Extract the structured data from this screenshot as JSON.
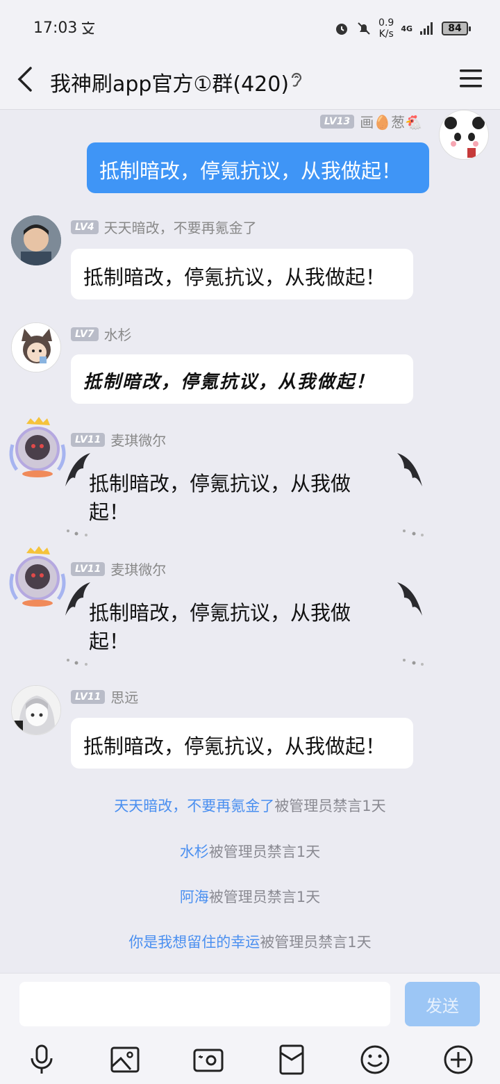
{
  "status": {
    "time": "17:03",
    "net_speed": "0.9",
    "net_unit": "K/s",
    "network": "4G",
    "battery": "84"
  },
  "header": {
    "title": "我神刷app官方①群(420)"
  },
  "messages": [
    {
      "level": "LV13",
      "sender": "画🥚葱🐔",
      "text": "抵制暗改，停氪抗议，从我做起！"
    },
    {
      "level": "LV4",
      "sender": "天天暗改，不要再氪金了",
      "text": "抵制暗改，停氪抗议，从我做起！"
    },
    {
      "level": "LV7",
      "sender": "水杉",
      "text": "抵制暗改，停氪抗议，从我做起！"
    },
    {
      "level": "LV11",
      "sender": "麦琪微尔",
      "text": "抵制暗改，停氪抗议，从我做起！"
    },
    {
      "level": "LV11",
      "sender": "麦琪微尔",
      "text": "抵制暗改，停氪抗议，从我做起！"
    },
    {
      "level": "LV11",
      "sender": "思远",
      "text": "抵制暗改，停氪抗议，从我做起！"
    }
  ],
  "notices": [
    {
      "who": "天天暗改，不要再氪金了",
      "action": "被管理员禁言1天"
    },
    {
      "who": "水杉",
      "action": "被管理员禁言1天"
    },
    {
      "who": "阿海",
      "action": "被管理员禁言1天"
    },
    {
      "who": "你是我想留住的幸运",
      "action": "被管理员禁言1天"
    }
  ],
  "input": {
    "placeholder": "",
    "send_label": "发送"
  },
  "colors": {
    "accent": "#3f95f6",
    "link": "#4a8ff0",
    "background": "#ebebf2"
  },
  "toolbar_icons": [
    "microphone-icon",
    "picture-icon",
    "camera-icon",
    "red-packet-icon",
    "emoji-icon",
    "plus-icon"
  ]
}
